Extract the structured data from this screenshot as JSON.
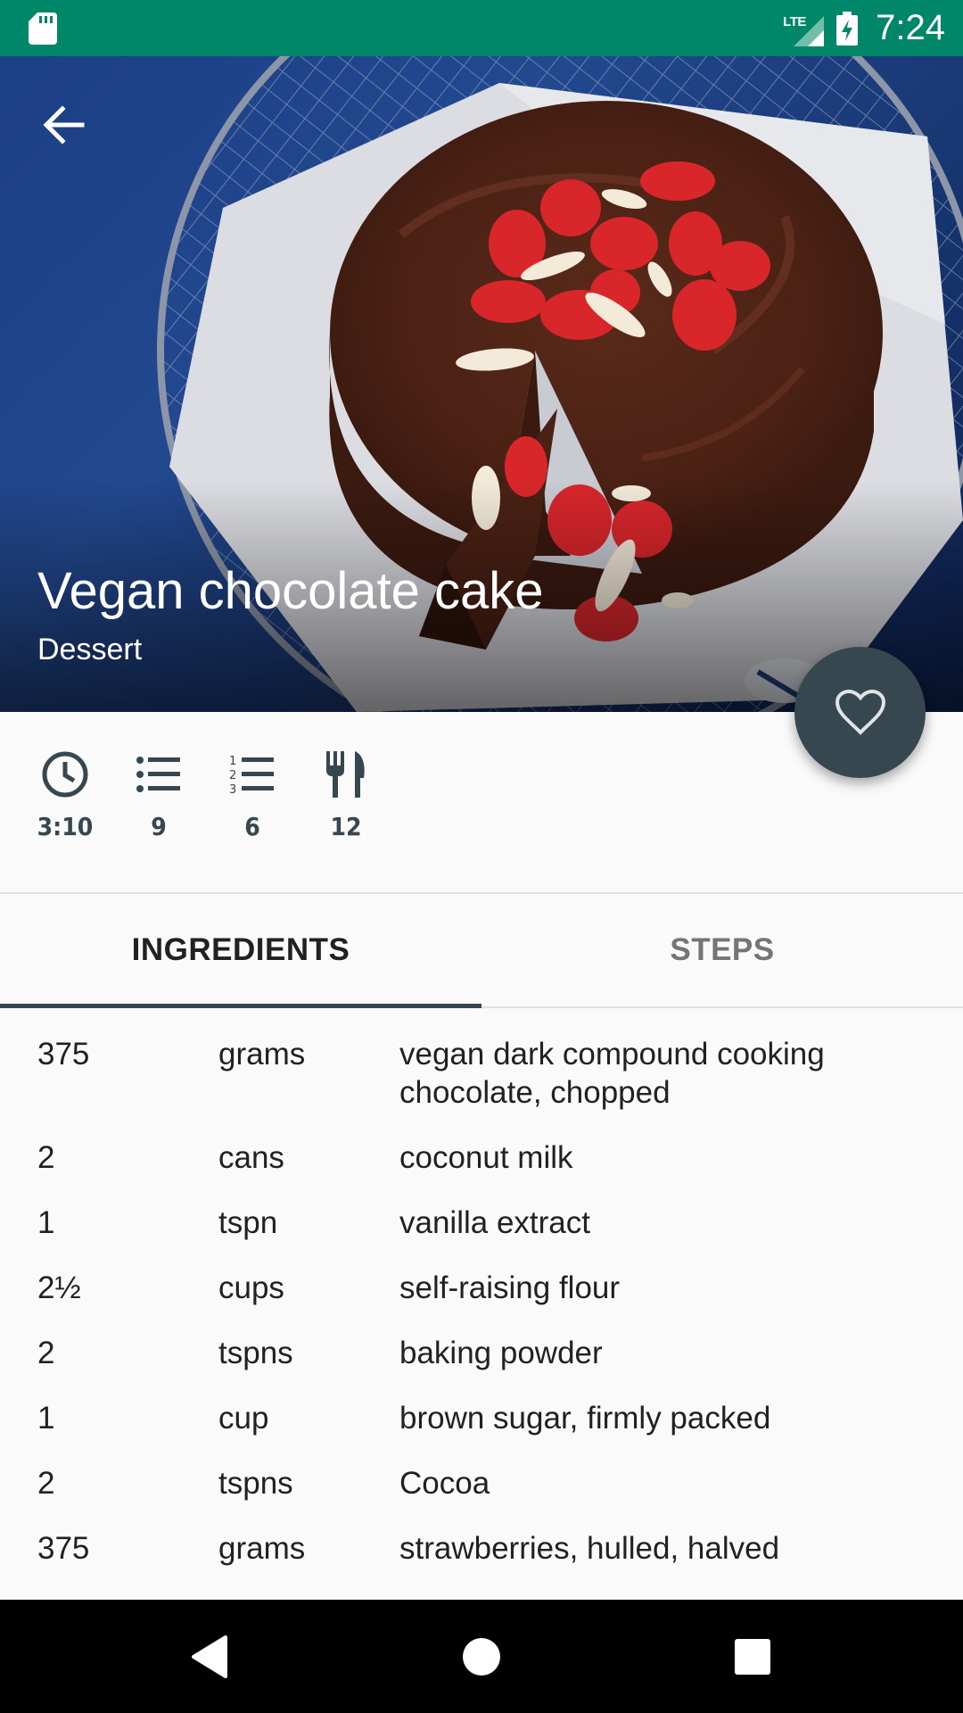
{
  "status_bar": {
    "time": "7:24",
    "network": "LTE",
    "icons": [
      "sd-card-icon",
      "signal-icon",
      "battery-charging-icon"
    ]
  },
  "header": {
    "back_icon": "arrow-back-icon",
    "title": "Vegan chocolate cake",
    "category": "Dessert"
  },
  "favorite_icon": "heart-outline-icon",
  "stats": [
    {
      "icon": "clock-icon",
      "value": "3:10"
    },
    {
      "icon": "list-icon",
      "value": "9"
    },
    {
      "icon": "numbered-list-icon",
      "value": "6"
    },
    {
      "icon": "utensils-icon",
      "value": "12"
    }
  ],
  "tabs": [
    {
      "label": "INGREDIENTS",
      "active": true
    },
    {
      "label": "STEPS",
      "active": false
    }
  ],
  "ingredients": [
    {
      "qty": "375",
      "unit": "grams",
      "name": "vegan dark compound cooking chocolate, chopped"
    },
    {
      "qty": "2",
      "unit": "cans",
      "name": "coconut milk"
    },
    {
      "qty": "1",
      "unit": "tspn",
      "name": "vanilla extract"
    },
    {
      "qty": "2½",
      "unit": "cups",
      "name": "self-raising flour"
    },
    {
      "qty": "2",
      "unit": "tspns",
      "name": "baking powder"
    },
    {
      "qty": "1",
      "unit": "cup",
      "name": "brown sugar, firmly packed"
    },
    {
      "qty": "2",
      "unit": "tspns",
      "name": "Cocoa"
    },
    {
      "qty": "375",
      "unit": "grams",
      "name": "strawberries, hulled, halved"
    }
  ],
  "nav_bar": [
    "back-triangle-icon",
    "home-circle-icon",
    "recents-square-icon"
  ],
  "colors": {
    "status_bar": "#00876a",
    "fab": "#37474f",
    "tab_indicator": "#37474f",
    "background": "#fafafa"
  }
}
